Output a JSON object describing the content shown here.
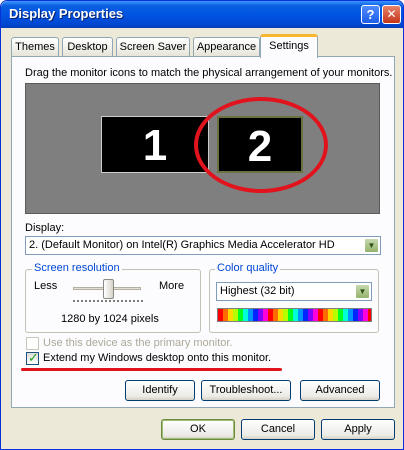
{
  "window": {
    "title": "Display Properties",
    "help_glyph": "?",
    "close_glyph": "✕"
  },
  "tabs": [
    {
      "label": "Themes"
    },
    {
      "label": "Desktop"
    },
    {
      "label": "Screen Saver"
    },
    {
      "label": "Appearance"
    },
    {
      "label": "Settings",
      "active": true
    }
  ],
  "settings": {
    "instruction": "Drag the monitor icons to match the physical arrangement of your monitors.",
    "monitors": [
      {
        "label": "1"
      },
      {
        "label": "2"
      }
    ],
    "display_label": "Display:",
    "display_value": "2. (Default Monitor) on Intel(R) Graphics Media Accelerator HD",
    "screen_resolution": {
      "title": "Screen resolution",
      "less": "Less",
      "more": "More",
      "value": "1280 by 1024 pixels",
      "slider_level": 0.55
    },
    "color_quality": {
      "title": "Color quality",
      "value": "Highest (32 bit)"
    },
    "primary_checkbox": {
      "label": "Use this device as the primary monitor.",
      "checked": false,
      "enabled": false
    },
    "extend_checkbox": {
      "label": "Extend my Windows desktop onto this monitor.",
      "checked": true
    },
    "buttons": {
      "identify": "Identify",
      "troubleshoot": "Troubleshoot...",
      "advanced": "Advanced"
    }
  },
  "dialog_buttons": {
    "ok": "OK",
    "cancel": "Cancel",
    "apply": "Apply"
  },
  "icons": {
    "dropdown": "chevron-down-icon",
    "check": "checkmark-icon"
  },
  "colors": {
    "title_bar": "#0054e3",
    "highlight_annotation": "#e1141e",
    "group_title": "#0046d5"
  }
}
